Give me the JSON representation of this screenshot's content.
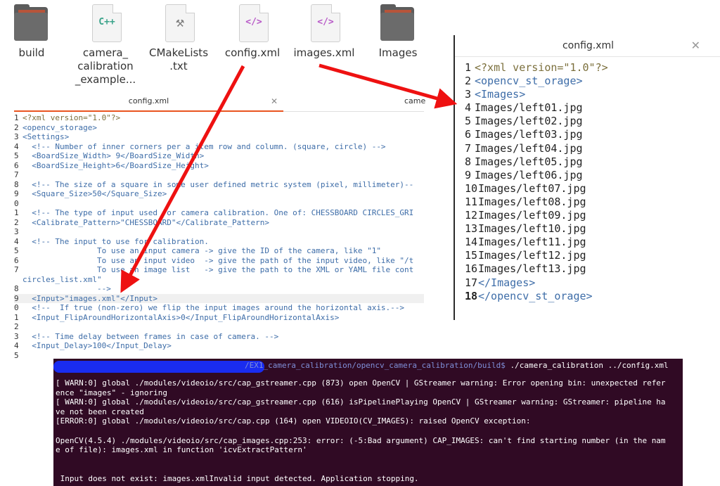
{
  "files": [
    {
      "name": "build",
      "icon": "folder-icon"
    },
    {
      "name": "camera_\ncalibration\n_example...",
      "icon": "cpp-file-icon",
      "glyph": "C++"
    },
    {
      "name": "CMakeLists\n.txt",
      "icon": "hammer-file-icon",
      "glyph": "⚒"
    },
    {
      "name": "config.xml",
      "icon": "xml-file-icon",
      "glyph": "</>"
    },
    {
      "name": "images.xml",
      "icon": "xml-file-icon",
      "glyph": "</>"
    },
    {
      "name": "Images",
      "icon": "folder-icon"
    }
  ],
  "left_editor": {
    "tab_active": "config.xml",
    "tab_close": "✕",
    "tab_next": "came",
    "lines": [
      {
        "n": "1",
        "t": "<?xml version=\"1.0\"?>"
      },
      {
        "n": "2",
        "t": "<opencv_storage>"
      },
      {
        "n": "3",
        "t": "<Settings>"
      },
      {
        "n": "4",
        "t": "  <!-- Number of inner corners per a item row and column. (square, circle) -->"
      },
      {
        "n": "5",
        "t": "  <BoardSize_Width> 9</BoardSize_Width>"
      },
      {
        "n": "6",
        "t": "  <BoardSize_Height>6</BoardSize_Height>"
      },
      {
        "n": "7",
        "t": ""
      },
      {
        "n": "8",
        "t": "  <!-- The size of a square in some user defined metric system (pixel, millimeter)--"
      },
      {
        "n": "9",
        "t": "  <Square_Size>50</Square_Size>"
      },
      {
        "n": "0",
        "t": ""
      },
      {
        "n": "1",
        "t": "  <!-- The type of input used for camera calibration. One of: CHESSBOARD CIRCLES_GRI"
      },
      {
        "n": "2",
        "t": "  <Calibrate_Pattern>\"CHESSBOARD\"</Calibrate_Pattern>"
      },
      {
        "n": "3",
        "t": ""
      },
      {
        "n": "4",
        "t": "  <!-- The input to use for calibration."
      },
      {
        "n": "5",
        "t": "                To use an input camera -> give the ID of the camera, like \"1\""
      },
      {
        "n": "6",
        "t": "                To use an input video  -> give the path of the input video, like \"/t"
      },
      {
        "n": "7",
        "t": "                To use an image list   -> give the path to the XML or YAML file cont"
      },
      {
        "n": "",
        "t": "circles_list.xml\""
      },
      {
        "n": "8",
        "t": "                -->"
      },
      {
        "n": "9",
        "t": "  <Input>\"images.xml\"</Input>"
      },
      {
        "n": "0",
        "t": "  <!--  If true (non-zero) we flip the input images around the horizontal axis.-->"
      },
      {
        "n": "1",
        "t": "  <Input_FlipAroundHorizontalAxis>0</Input_FlipAroundHorizontalAxis>"
      },
      {
        "n": "2",
        "t": ""
      },
      {
        "n": "3",
        "t": "  <!-- Time delay between frames in case of camera. -->"
      },
      {
        "n": "4",
        "t": "  <Input_Delay>100</Input_Delay>"
      },
      {
        "n": "5",
        "t": ""
      }
    ]
  },
  "right_editor": {
    "title": "config.xml",
    "close": "✕",
    "lines": [
      {
        "n": "1",
        "t": "<?xml version=\"1.0\"?>"
      },
      {
        "n": "2",
        "t": "<opencv_st_orage>"
      },
      {
        "n": "3",
        "t": "<Images>"
      },
      {
        "n": "4",
        "t": "Images/left01.jpg"
      },
      {
        "n": "5",
        "t": "Images/left02.jpg"
      },
      {
        "n": "6",
        "t": "Images/left03.jpg"
      },
      {
        "n": "7",
        "t": "Images/left04.jpg"
      },
      {
        "n": "8",
        "t": "Images/left05.jpg"
      },
      {
        "n": "9",
        "t": "Images/left06.jpg"
      },
      {
        "n": "10",
        "t": "Images/left07.jpg"
      },
      {
        "n": "11",
        "t": "Images/left08.jpg"
      },
      {
        "n": "12",
        "t": "Images/left09.jpg"
      },
      {
        "n": "13",
        "t": "Images/left10.jpg"
      },
      {
        "n": "14",
        "t": "Images/left11.jpg"
      },
      {
        "n": "15",
        "t": "Images/left12.jpg"
      },
      {
        "n": "16",
        "t": "Images/left13.jpg"
      },
      {
        "n": "17",
        "t": "</Images>"
      },
      {
        "n": "18",
        "t": "</opencv_st_orage>"
      }
    ]
  },
  "terminal": {
    "prompt_path": "/EX1_camera_calibration/opencv_camera_calibration/build$",
    "command": " ./camera_calibration ../config.xml",
    "lines": [
      "[ WARN:0] global ./modules/videoio/src/cap_gstreamer.cpp (873) open OpenCV | GStreamer warning: Error opening bin: unexpected refer",
      "ence \"images\" - ignoring",
      "[ WARN:0] global ./modules/videoio/src/cap_gstreamer.cpp (616) isPipelinePlaying OpenCV | GStreamer warning: GStreamer: pipeline ha",
      "ve not been created",
      "[ERROR:0] global ./modules/videoio/src/cap.cpp (164) open VIDEOIO(CV_IMAGES): raised OpenCV exception:",
      "",
      "OpenCV(4.5.4) ./modules/videoio/src/cap_images.cpp:253: error: (-5:Bad argument) CAP_IMAGES: can't find starting number (in the nam",
      "e of file): images.xml in function 'icvExtractPattern'",
      "",
      "",
      " Input does not exist: images.xmlInvalid input detected. Application stopping."
    ]
  },
  "colors": {
    "terminal_bg": "#300a24",
    "arrow": "#ee1111",
    "tab_accent": "#e95420",
    "redaction": "#1a2cf0"
  }
}
